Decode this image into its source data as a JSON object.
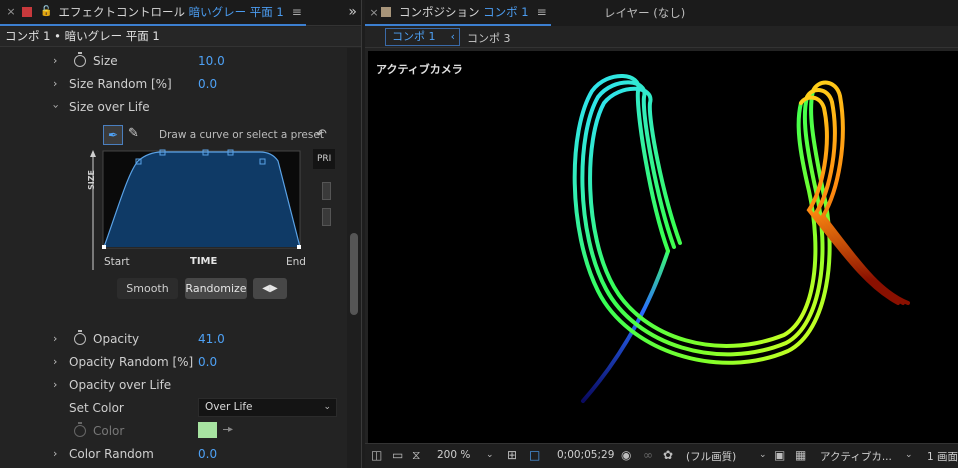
{
  "effect_controls": {
    "tab": {
      "close": "×",
      "lock": "🔓",
      "title_prefix": "エフェクトコントロール",
      "title_layer": "暗いグレー 平面 1",
      "menu": "≡",
      "more": "»",
      "swatch_color": "#c8393c"
    },
    "header": "コンポ 1 • 暗いグレー 平面 1",
    "properties": [
      {
        "label": "Size",
        "value": "10.0"
      },
      {
        "label": "Size Random [%]",
        "value": "0.0"
      },
      {
        "label": "Size over Life"
      }
    ],
    "curve": {
      "hint": "Draw a curve or select a preset",
      "presets_label": "PRI",
      "y_axis": "SIZE",
      "x_start": "Start",
      "x_mid": "TIME",
      "x_end": "End",
      "buttons": {
        "smooth": "Smooth",
        "randomize": "Randomize",
        "step": "◀▶"
      },
      "fill_color": "#0f3a66",
      "line_color": "#5aa2e6"
    },
    "lower_properties": {
      "opacity": {
        "label": "Opacity",
        "value": "41.0"
      },
      "opacity_random": {
        "label": "Opacity Random [%]",
        "value": "0.0"
      },
      "opacity_over_life": {
        "label": "Opacity over Life"
      },
      "set_color": {
        "label": "Set Color",
        "value": "Over Life"
      },
      "color": {
        "label": "Color",
        "swatch": "#a7e3a1"
      },
      "color_random": {
        "label": "Color Random",
        "value": "0.0"
      }
    }
  },
  "composition": {
    "tab": {
      "close": "×",
      "title_prefix": "コンポジション",
      "title_comp": "コンポ 1",
      "menu": "≡",
      "swatch_color": "#a8957a"
    },
    "layer_tab": "レイヤー (なし)",
    "subtabs": {
      "active": "コンポ 1",
      "active_arrow": "‹",
      "other": "コンポ 3"
    },
    "viewer": {
      "camera": "アクティブカメラ"
    },
    "footer": {
      "zoom": "200 %",
      "timecode": "0;00;05;29",
      "resolution": "(フル画質)",
      "view": "アクティブカ...",
      "views": "1 画面"
    }
  }
}
